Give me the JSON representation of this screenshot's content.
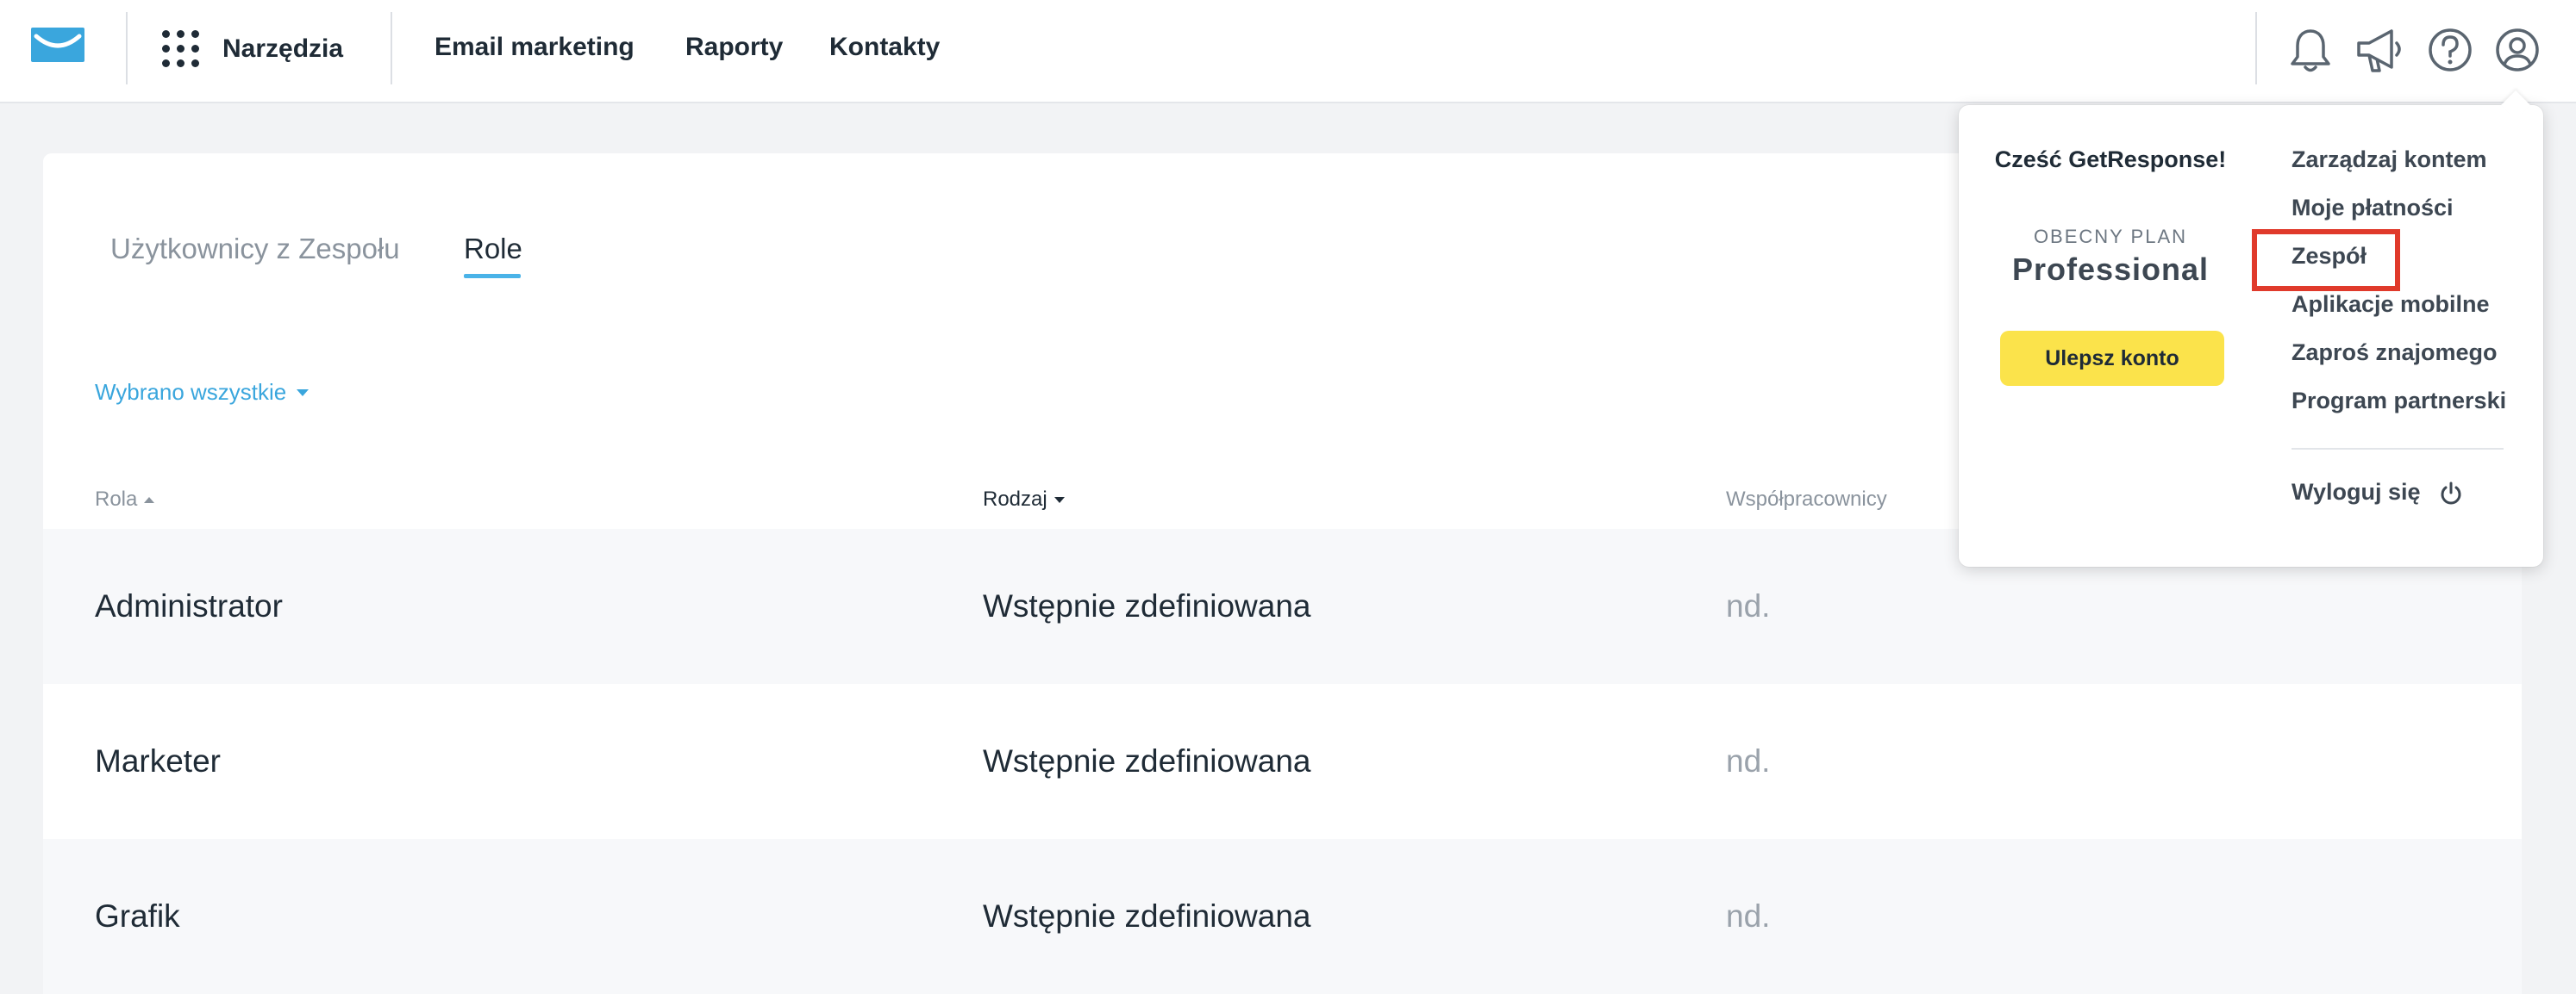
{
  "topbar": {
    "apps_label": "Narzędzia",
    "nav": [
      "Email marketing",
      "Raporty",
      "Kontakty"
    ],
    "icons": [
      "bell-icon",
      "megaphone-icon",
      "help-icon",
      "user-account-icon"
    ]
  },
  "tabs": [
    {
      "label": "Użytkownicy z Zespołu",
      "active": false
    },
    {
      "label": "Role",
      "active": true
    }
  ],
  "filter": {
    "label": "Wybrano wszystkie"
  },
  "table": {
    "headers": [
      "Rola",
      "Rodzaj",
      "Współpracownicy"
    ],
    "rows": [
      {
        "role": "Administrator",
        "type": "Wstępnie zdefiniowana",
        "collaborators": "nd."
      },
      {
        "role": "Marketer",
        "type": "Wstępnie zdefiniowana",
        "collaborators": "nd."
      },
      {
        "role": "Grafik",
        "type": "Wstępnie zdefiniowana",
        "collaborators": "nd."
      }
    ]
  },
  "dropdown": {
    "greeting": "Cześć GetResponse!",
    "plan_label": "OBECNY PLAN",
    "plan_name": "Professional",
    "upgrade_label": "Ulepsz konto",
    "menu": [
      "Zarządzaj kontem",
      "Moje płatności",
      "Zespół",
      "Aplikacje mobilne",
      "Zaproś znajomego",
      "Program partnerski"
    ],
    "logout_label": "Wyloguj się",
    "highlighted_item": "Zespół"
  },
  "colors": {
    "accent": "#4ab3e8",
    "link": "#3aa6dd",
    "upgrade_button": "#fbe34b",
    "highlight_box": "#e03a2b",
    "logo": "#3aa6dd"
  }
}
